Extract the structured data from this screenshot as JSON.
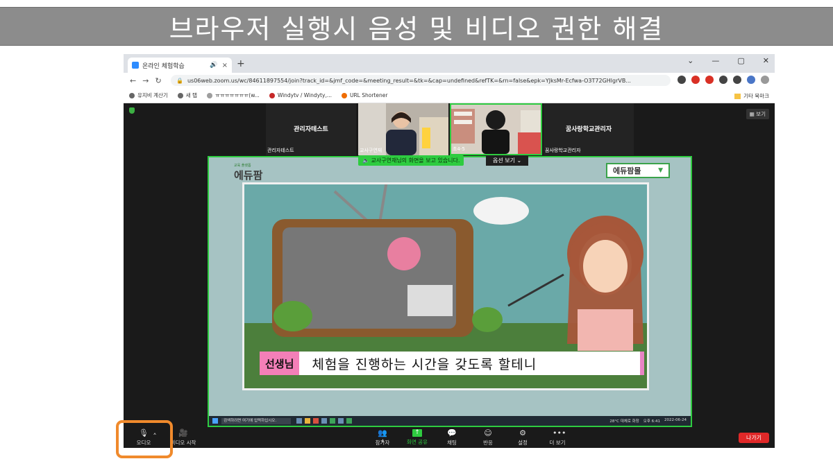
{
  "slide": {
    "title": "브라우저 실행시 음성 및 비디오 권한 해결"
  },
  "browser": {
    "tab": {
      "title": "온라인 체험학습",
      "close": "×"
    },
    "new_tab": "+",
    "window_controls": [
      "⌄",
      "—",
      "▢",
      "✕"
    ],
    "nav": [
      "←",
      "→",
      "↻"
    ],
    "url": "us06web.zoom.us/wc/84611897554/join?track_id=&jmf_code=&meeting_result=&tk=&cap=undefined&refTK=&rn=false&epk=YJksMr-Ecfwa-O3T72GHlgrVB...",
    "bookmarks": [
      {
        "label": "유지비 계산기",
        "icon": "github-icon"
      },
      {
        "label": "새 탭",
        "icon": "github-icon"
      },
      {
        "label": "ㅠㅠㅠㅠㅠㅠㅠ(w...",
        "icon": "circle-icon"
      },
      {
        "label": "Windytv / Windyty,...",
        "icon": "windy-icon"
      },
      {
        "label": "URL Shortener",
        "icon": "shortener-icon"
      }
    ],
    "other_bookmarks": "기타 북마크"
  },
  "zoom": {
    "view_button": "보기",
    "participants": [
      {
        "center_name": "관리자테스트",
        "corner_name": "관리자테스트",
        "video": false
      },
      {
        "center_name": "",
        "corner_name": "교사구연재",
        "video": true
      },
      {
        "center_name": "",
        "corner_name": "초4-5",
        "video": true
      },
      {
        "center_name": "꿈사랑학교관리자",
        "corner_name": "꿈사랑학교관리자",
        "video": false
      }
    ],
    "share_banner": "교사구연재님의 화면을 보고 있습니다.",
    "view_options": "옵션 보기 ⌄",
    "shared_screen": {
      "logo_small": "교육 플랫폼",
      "logo": "에듀팜",
      "mall_button": "에듀팜몰",
      "subtitle_speaker": "선생님",
      "subtitle_text": "체험을 진행하는 시간을 갖도록 할테니",
      "taskbar_search": "검색하려면 여기에 입력하십시오.",
      "taskbar_weather": "28°C 대체로 화창",
      "taskbar_time": "오후 6:41",
      "taskbar_date": "2022-06-24"
    },
    "toolbar": {
      "audio": "오디오",
      "video": "비디오 시작",
      "participants": "참가자",
      "participants_count": "4",
      "share": "화면 공유",
      "chat": "채팅",
      "reactions": "반응",
      "settings": "설정",
      "more": "더 보기",
      "leave": "나가기"
    }
  }
}
